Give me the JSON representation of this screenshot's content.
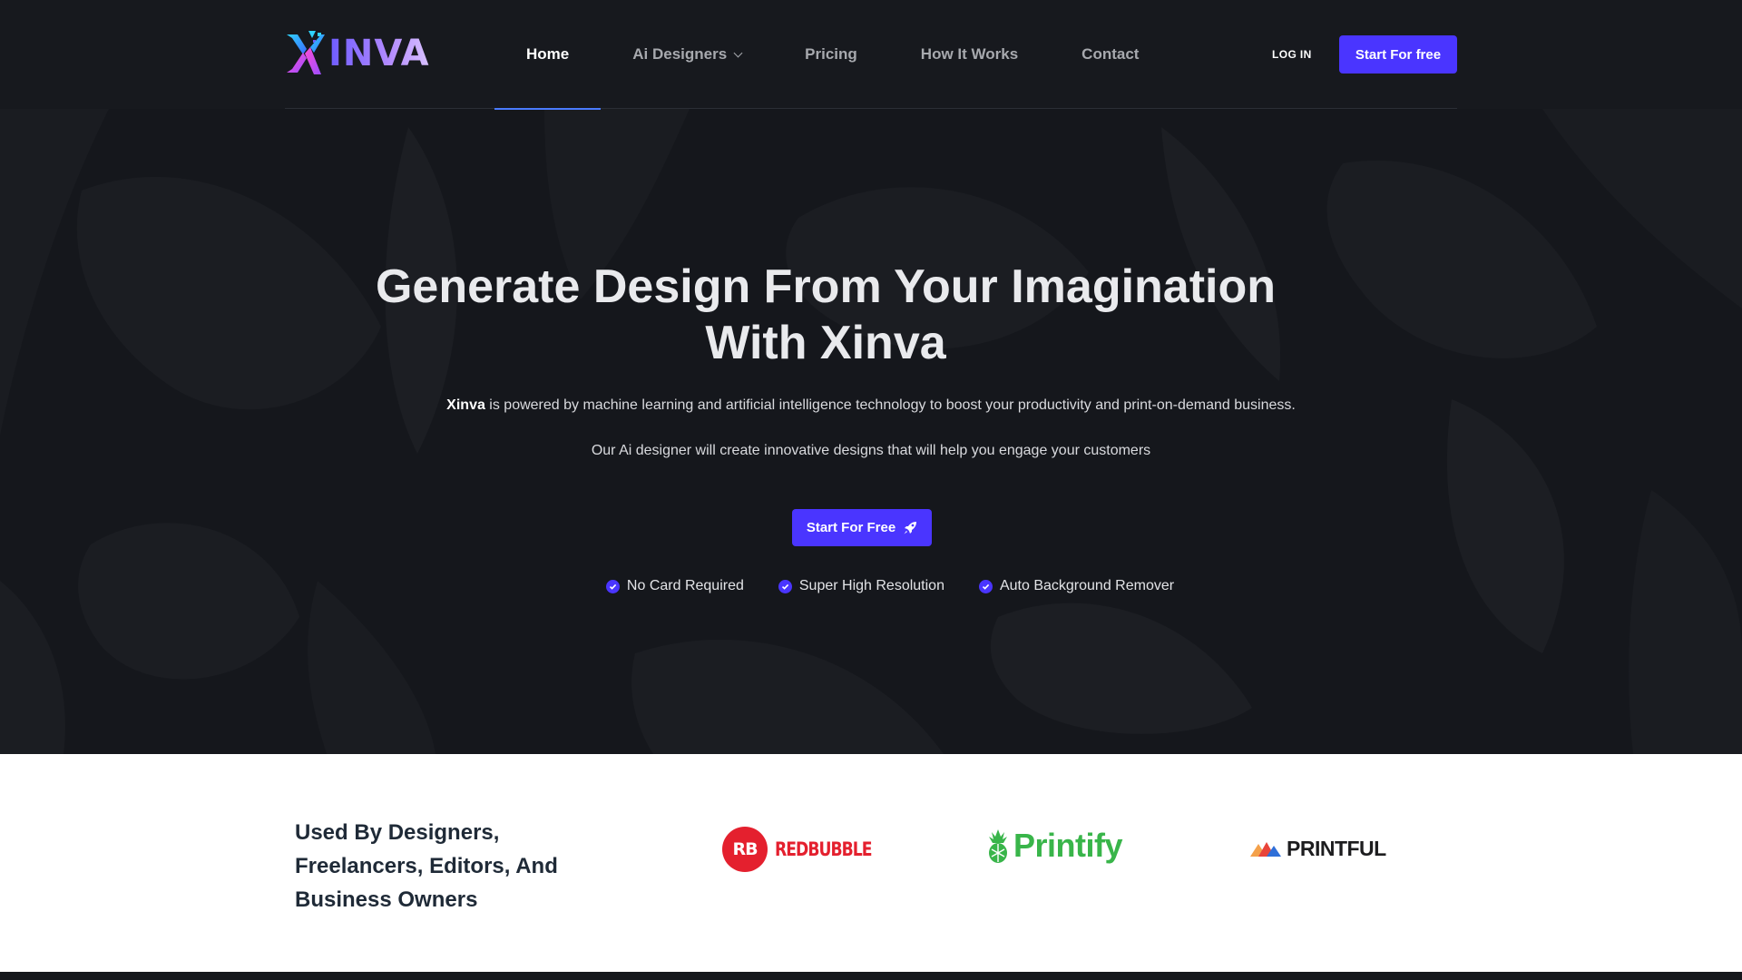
{
  "header": {
    "logo_text": "INVA",
    "nav": [
      {
        "label": "Home",
        "active": true
      },
      {
        "label": "Ai Designers",
        "dropdown": true
      },
      {
        "label": "Pricing"
      },
      {
        "label": "How It Works"
      },
      {
        "label": "Contact"
      }
    ],
    "login_label": "LOG IN",
    "start_label": "Start For free"
  },
  "hero": {
    "title_line1": "Generate Design From Your Imagination",
    "title_line2": "With Xinva",
    "desc_brand": "Xinva",
    "desc_rest": " is powered by machine learning and artificial intelligence technology to boost your productivity and print-on-demand business.",
    "desc_line2": "Our Ai designer will create innovative designs that will help you engage your customers",
    "cta_label": "Start For Free",
    "features": [
      "No Card Required",
      "Super High Resolution",
      "Auto Background Remover"
    ]
  },
  "trust": {
    "title": "Used By Designers, Freelancers, Editors, And Business Owners",
    "brands": [
      {
        "name": "REDBUBBLE",
        "mark": "RB"
      },
      {
        "name": "Printify"
      },
      {
        "name": "PRINTFUL"
      }
    ]
  },
  "colors": {
    "accent": "#4a35ff",
    "nav_underline": "#4a7bff",
    "hero_bg": "#15171c",
    "redbubble": "#e4202e",
    "printify": "#39b54a"
  }
}
